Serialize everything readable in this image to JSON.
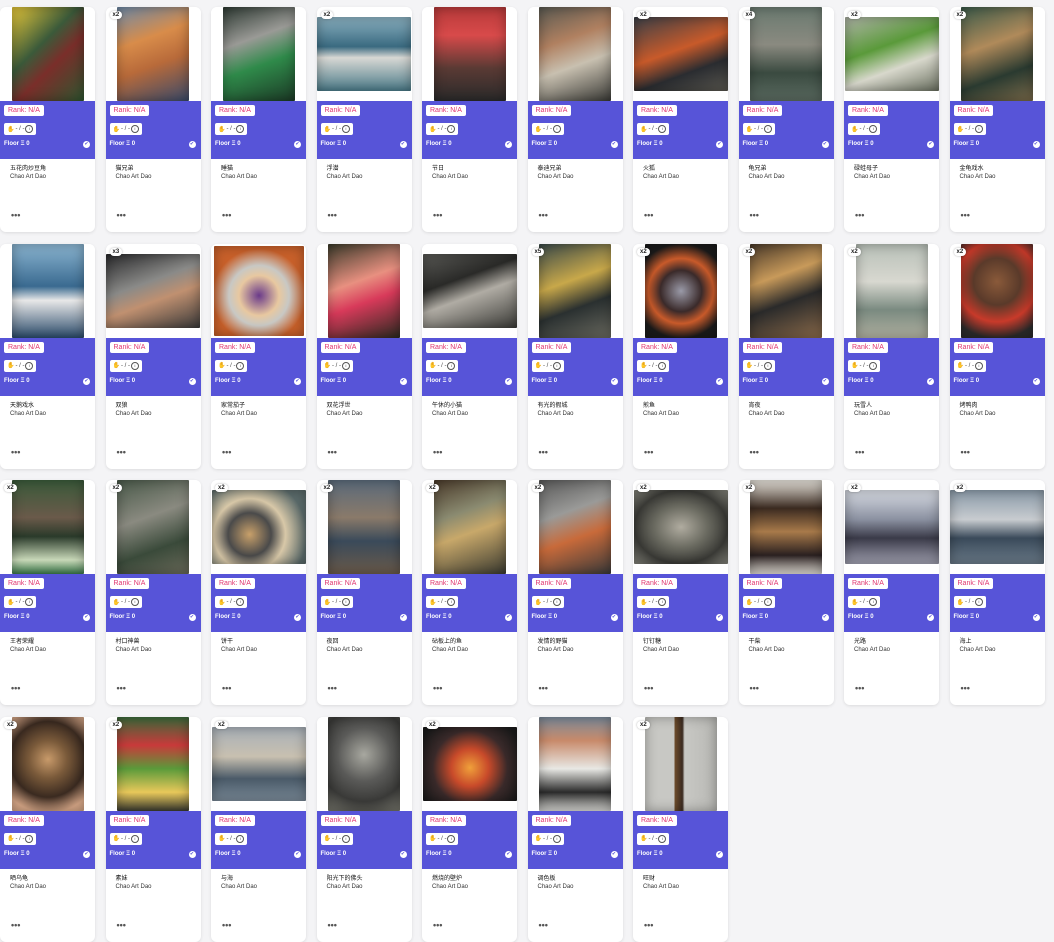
{
  "common": {
    "rank": "Rank: N/A",
    "stats": "- / -",
    "floor": "Floor Ξ 0",
    "creator": "Chao Art Dao",
    "more": "•••",
    "panel_color": "#5754d8",
    "rank_color": "#e0356f"
  },
  "cards": [
    {
      "title": "五花肉炒豆角",
      "edition": "",
      "shape": "tall",
      "bg": "linear-gradient(135deg,#e8c93a 0%,#3b5a3a 40%,#7a2e2a 60%,#2f5630 100%)"
    },
    {
      "title": "猫兄弟",
      "edition": "x2",
      "shape": "tall",
      "bg": "linear-gradient(160deg,#6e8aa8 0%,#d88c4a 35%,#b86a3a 60%,#3a4a6a 100%)"
    },
    {
      "title": "睡猫",
      "edition": "",
      "shape": "tall",
      "bg": "linear-gradient(160deg,#2e3a33 0%,#9a9a96 35%,#2f8a4a 60%,#1c3a26 100%)"
    },
    {
      "title": "浮潜",
      "edition": "x2",
      "shape": "wide",
      "bg": "linear-gradient(180deg,#8ab0c0 0%,#3a6a80 40%,#d8d8d4 55%,#4a7a88 100%)"
    },
    {
      "title": "节日",
      "edition": "",
      "shape": "tall",
      "bg": "linear-gradient(180deg,#b83a3a 0%,#d84a4a 30%,#5a3a34 65%,#2a2a2a 100%)"
    },
    {
      "title": "泰迪兄弟",
      "edition": "",
      "shape": "tall",
      "bg": "linear-gradient(160deg,#5a5a52 0%,#b08060 35%,#c8c0b0 60%,#3a3a36 100%)"
    },
    {
      "title": "火狐",
      "edition": "x2",
      "shape": "wide",
      "bg": "linear-gradient(160deg,#3a4048 0%,#c85a2a 45%,#2a2c30 70%,#5a5850 100%)"
    },
    {
      "title": "龟兄弟",
      "edition": "x4",
      "shape": "tall",
      "bg": "linear-gradient(180deg,#6a7a70 0%,#8a8a80 40%,#3a4a40 70%,#5a6a60 100%)"
    },
    {
      "title": "碌蛙母子",
      "edition": "x2",
      "shape": "wide",
      "bg": "linear-gradient(160deg,#b0b4a8 0%,#5a9a3a 40%,#d8d8cc 65%,#6a7060 100%)"
    },
    {
      "title": "金龟戏水",
      "edition": "x2",
      "shape": "tall",
      "bg": "linear-gradient(160deg,#3a5a4a 0%,#b08a5a 40%,#2a3a30 70%,#7a6a4a 100%)"
    },
    {
      "title": "天鹅戏水",
      "edition": "",
      "shape": "tall",
      "bg": "linear-gradient(180deg,#8ab4d0 0%,#3a6a90 45%,#e8e8e8 60%,#2a4a6a 100%)"
    },
    {
      "title": "双狼",
      "edition": "x3",
      "shape": "wide",
      "bg": "linear-gradient(160deg,#2a2a2c 0%,#8a8a88 40%,#c09070 60%,#3a3a3a 100%)"
    },
    {
      "title": "家常茄子",
      "edition": "",
      "shape": "square",
      "bg": "radial-gradient(circle at 50% 55%,#6a3a8a 0%,#e8c8a0 30%,#c8c8c4 45%,#c8602a 70%)"
    },
    {
      "title": "双花浮世",
      "edition": "",
      "shape": "tall",
      "bg": "linear-gradient(160deg,#3a3a2a 0%,#e89080 40%,#d83a5a 60%,#2a2a20 100%)"
    },
    {
      "title": "午休的小猫",
      "edition": "",
      "shape": "wide",
      "bg": "linear-gradient(160deg,#5a5a56 0%,#2a2a28 35%,#b0aca4 55%,#3a3a36 100%)"
    },
    {
      "title": "有光的假城",
      "edition": "x5",
      "shape": "tall",
      "bg": "linear-gradient(160deg,#3a4a4a 0%,#c8a84a 40%,#2a3030 65%,#6a6a60 100%)"
    },
    {
      "title": "煎鱼",
      "edition": "x2",
      "shape": "tall",
      "bg": "radial-gradient(circle at 50% 50%,#9a9aa8 0%,#3a2a2a 35%,#c85a2a 55%,#1a1a1a 80%)"
    },
    {
      "title": "宵夜",
      "edition": "x2",
      "shape": "tall",
      "bg": "linear-gradient(160deg,#4a3a2a 0%,#c89a5a 35%,#2a2a2a 60%,#8a6a4a 100%)"
    },
    {
      "title": "玩雪人",
      "edition": "x2",
      "shape": "tall",
      "bg": "linear-gradient(180deg,#b8c0b8 0%,#d8d8d0 40%,#7a8a80 70%,#b0b0a0 100%)"
    },
    {
      "title": "烤鸭肉",
      "edition": "x2",
      "shape": "tall",
      "bg": "radial-gradient(circle at 50% 40%,#8a5a3a 0%,#5a3a2a 35%,#c83a2a 60%,#2a2a2a 85%)"
    },
    {
      "title": "王者荣耀",
      "edition": "x2",
      "shape": "tall",
      "bg": "linear-gradient(180deg,#3a5a3a 0%,#6a5a4a 40%,#2a3a2a 60%,#c8d8b8 85%,#3a7a4a 100%)"
    },
    {
      "title": "村口神兽",
      "edition": "x2",
      "shape": "tall",
      "bg": "linear-gradient(160deg,#4a5a4a 0%,#8a8a80 40%,#3a4a3a 70%,#6a6a5a 100%)"
    },
    {
      "title": "饼干",
      "edition": "x2",
      "shape": "wide",
      "bg": "radial-gradient(circle at 40% 60%,#c8a06a 0%,#4a4a4a 30%,#d8c8a8 50%,#5a6a6a 80%)"
    },
    {
      "title": "夜回",
      "edition": "x2",
      "shape": "tall",
      "bg": "linear-gradient(180deg,#5a6a7a 0%,#8a7a6a 40%,#3a4a5a 65%,#6a5a4a 100%)"
    },
    {
      "title": "砧板上的鱼",
      "edition": "x2",
      "shape": "tall",
      "bg": "linear-gradient(160deg,#4a3a2a 0%,#8a8a70 35%,#c8a86a 55%,#3a3a30 100%)"
    },
    {
      "title": "发情的野猫",
      "edition": "x2",
      "shape": "tall",
      "bg": "linear-gradient(160deg,#5a5a5a 0%,#9a9a98 35%,#c86a3a 60%,#3a3a3a 100%)"
    },
    {
      "title": "钉钉糖",
      "edition": "x2",
      "shape": "wide",
      "bg": "radial-gradient(ellipse at 50% 50%,#b0aca0 0%,#6a6a60 40%,#3a3a36 70%,#8a8a80 100%)"
    },
    {
      "title": "干柴",
      "edition": "x2",
      "shape": "tall",
      "bg": "linear-gradient(180deg,#e8e4dc 0%,#3a2a20 30%,#a87a4a 55%,#2a2020 80%,#e0dcd4 100%)"
    },
    {
      "title": "光路",
      "edition": "x2",
      "shape": "wide",
      "bg": "linear-gradient(180deg,#d8dce4 0%,#8a90a0 40%,#3a3a48 65%,#a0a0b0 100%)"
    },
    {
      "title": "海上",
      "edition": "x2",
      "shape": "wide",
      "bg": "linear-gradient(180deg,#8a9aa8 0%,#c8ccd0 40%,#3a4a5a 65%,#6a7a88 100%)"
    },
    {
      "title": "晒乌龟",
      "edition": "x2",
      "shape": "tall",
      "bg": "radial-gradient(circle at 50% 45%,#c89a6a 0%,#7a5a3a 30%,#3a2a20 60%,#d8a888 85%)"
    },
    {
      "title": "素妹",
      "edition": "x2",
      "shape": "tall",
      "bg": "linear-gradient(180deg,#3a6a3a 0%,#c83a3a 30%,#5a9a3a 55%,#e8c85a 80%,#3a3a30 100%)"
    },
    {
      "title": "与海",
      "edition": "x2",
      "shape": "wide",
      "bg": "linear-gradient(180deg,#a8b0b8 0%,#c8c0b0 40%,#4a5a68 70%,#7a8a98 100%)"
    },
    {
      "title": "阳光下的佛头",
      "edition": "",
      "shape": "tall",
      "bg": "radial-gradient(circle at 50% 40%,#a8a8a0 0%,#5a5a58 40%,#3a3a38 70%,#7a7a70 100%)"
    },
    {
      "title": "燃烧的壁炉",
      "edition": "x2",
      "shape": "wide",
      "bg": "radial-gradient(circle at 50% 55%,#f0a03a 0%,#c84a2a 30%,#3a2a2a 60%,#1a1a1a 90%)"
    },
    {
      "title": "调色板",
      "edition": "",
      "shape": "tall",
      "bg": "linear-gradient(180deg,#7a8a9a 0%,#c88a6a 25%,#e8e8e4 55%,#2a2a2a 80%,#d8d8d4 100%)"
    },
    {
      "title": "旺财",
      "edition": "x2",
      "shape": "tall",
      "bg": "linear-gradient(90deg,#c8c8c4 0%,#c8c8c4 40%,#6a4a2a 42%,#3a2a20 52%,#c8c8c4 55%,#b8b8b4 100%)"
    }
  ]
}
